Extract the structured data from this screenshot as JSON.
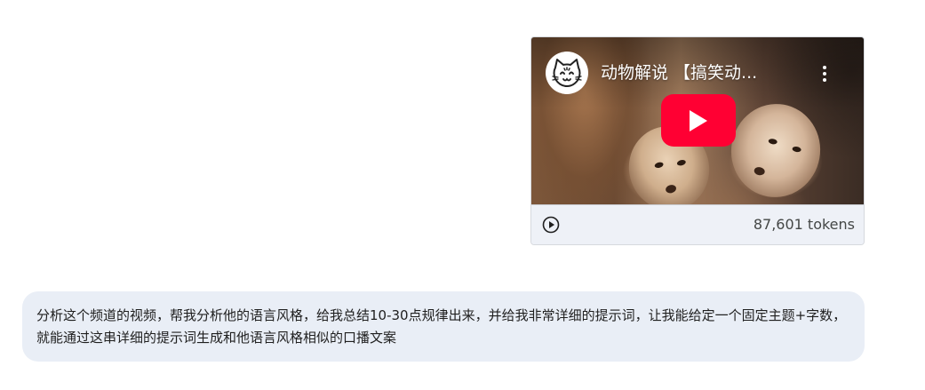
{
  "video": {
    "title": "动物解说 【搞笑动...",
    "channel_avatar_icon": "cat-face-icon",
    "more_icon": "more-vertical-icon",
    "play_icon": "youtube-play-icon",
    "token_count": "87,601 tokens",
    "footer_play_icon": "play-circle-icon",
    "accent_color": "#ff0033"
  },
  "prompt": {
    "text": "分析这个频道的视频，帮我分析他的语言风格，给我总结10-30点规律出来，并给我非常详细的提示词，让我能给定一个固定主题+字数，就能通过这串详细的提示词生成和他语言风格相似的口播文案",
    "background_color": "#e9eef6"
  }
}
